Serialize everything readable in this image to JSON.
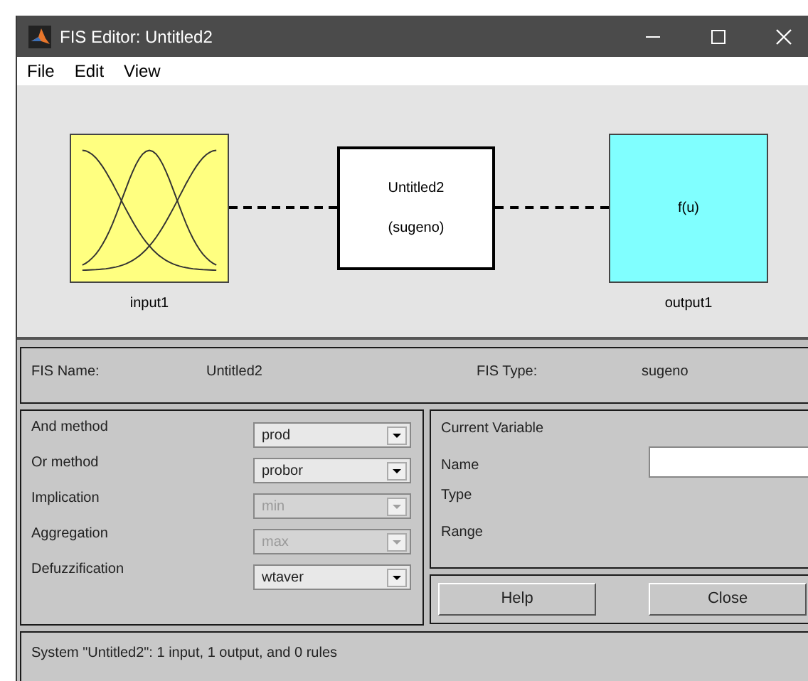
{
  "window": {
    "title": "FIS Editor: Untitled2"
  },
  "menu": [
    "File",
    "Edit",
    "View"
  ],
  "diagram": {
    "input": {
      "label": "input1"
    },
    "system": {
      "name": "Untitled2",
      "type": "(sugeno)"
    },
    "output": {
      "text": "f(u)",
      "label": "output1"
    }
  },
  "fis_name": {
    "label": "FIS Name:",
    "value": "Untitled2"
  },
  "fis_type": {
    "label": "FIS Type:",
    "value": "sugeno"
  },
  "methods": [
    {
      "label": "And method",
      "value": "prod",
      "disabled": false
    },
    {
      "label": "Or method",
      "value": "probor",
      "disabled": false
    },
    {
      "label": "Implication",
      "value": "min",
      "disabled": true
    },
    {
      "label": "Aggregation",
      "value": "max",
      "disabled": true
    },
    {
      "label": "Defuzzification",
      "value": "wtaver",
      "disabled": false
    }
  ],
  "current_variable": {
    "title": "Current Variable",
    "name_label": "Name",
    "type_label": "Type",
    "range_label": "Range"
  },
  "buttons": [
    "Help",
    "Close"
  ],
  "status": "System \"Untitled2\": 1 input, 1 output, and 0 rules"
}
